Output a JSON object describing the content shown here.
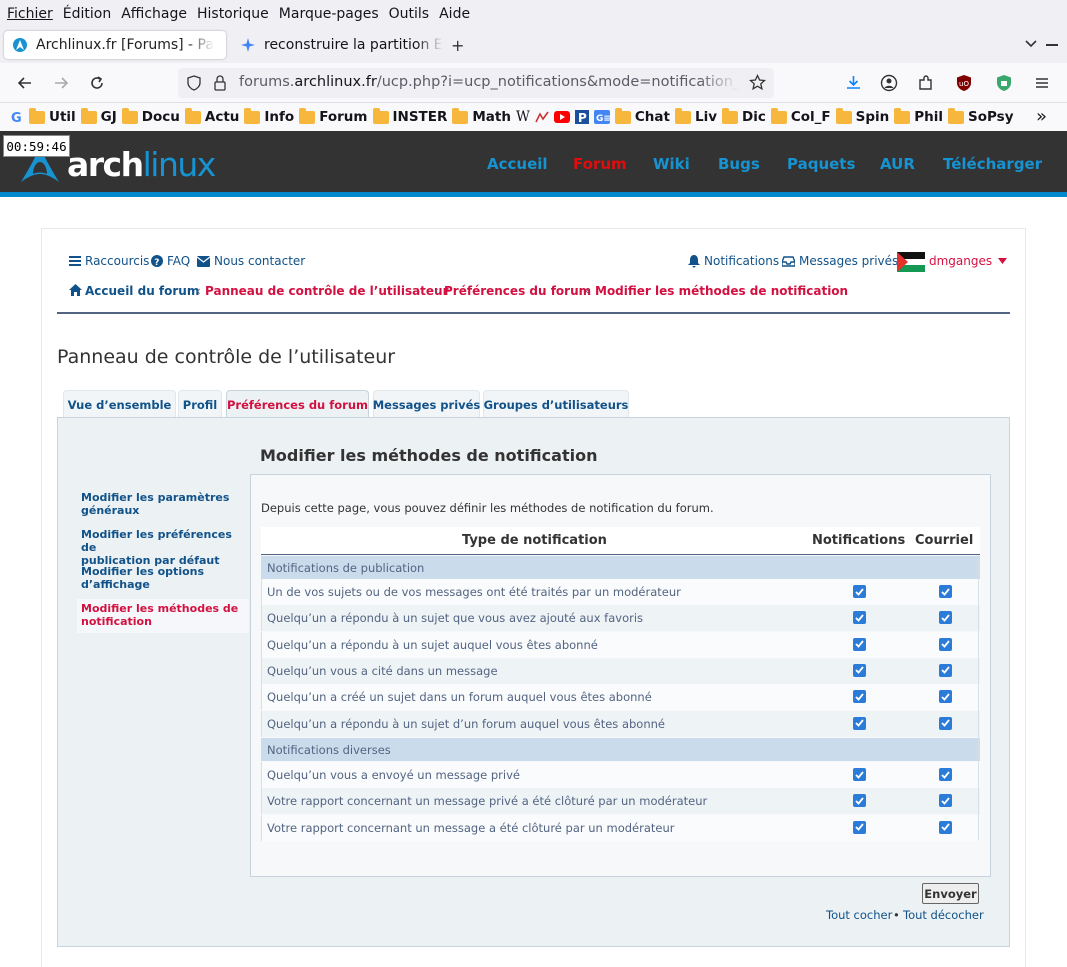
{
  "browser": {
    "menu": [
      "Fichier",
      "Édition",
      "Affichage",
      "Historique",
      "Marque-pages",
      "Outils",
      "Aide"
    ],
    "tabs": [
      {
        "title": "Archlinux.fr [Forums] - Pa"
      },
      {
        "title": "reconstruire la partition E"
      }
    ],
    "new_tab": "+",
    "url": {
      "prefix": "forums.",
      "domain": "archlinux.fr",
      "path": "/ucp.php?i=ucp_notifications&mode=notification_op"
    },
    "bookmarks": [
      "Util",
      "GJ",
      "Docu",
      "Actu",
      "Info",
      "Forum",
      "INSTER",
      "Math",
      "Chat",
      "Liv",
      "Dic",
      "Col_F",
      "Spin",
      "Phil",
      "SoPsy"
    ],
    "bookmark_overflow": "»"
  },
  "timer": "00:59:46",
  "arch": {
    "logo_part1": "arch",
    "logo_part2": "linux",
    "nav": [
      "Accueil",
      "Forum",
      "Wiki",
      "Bugs",
      "Paquets",
      "AUR",
      "Télécharger"
    ],
    "nav_active": "Forum"
  },
  "forum": {
    "top_links": {
      "shortcuts": "Raccourcis",
      "faq": "FAQ",
      "contact": "Nous contacter"
    },
    "user_links": {
      "notifications": "Notifications",
      "pm": "Messages privés",
      "username": "dmganges"
    },
    "breadcrumb": [
      "Accueil du forum",
      "Panneau de contrôle de l’utilisateur",
      "Préférences du forum",
      "Modifier les méthodes de notification"
    ],
    "panel_title": "Panneau de contrôle de l’utilisateur",
    "tabs": [
      "Vue d’ensemble",
      "Profil",
      "Préférences du forum",
      "Messages privés",
      "Groupes d’utilisateurs"
    ],
    "active_tab": "Préférences du forum",
    "sidebar": [
      {
        "line1": "Modifier les paramètres",
        "line2": "généraux"
      },
      {
        "line1": "Modifier les préférences de",
        "line2": "publication par défaut"
      },
      {
        "line1": "Modifier les options",
        "line2": "d’affichage"
      },
      {
        "line1": "Modifier les méthodes de",
        "line2": "notification"
      }
    ],
    "content_title": "Modifier les méthodes de notification",
    "description": "Depuis cette page, vous pouvez définir les méthodes de notification du forum.",
    "table": {
      "headers": {
        "type": "Type de notification",
        "notifications": "Notifications",
        "email": "Courriel"
      },
      "section1": "Notifications de publication",
      "rows1": [
        {
          "label": "Un de vos sujets ou de vos messages ont été traités par un modérateur",
          "notif": true,
          "email": true
        },
        {
          "label": "Quelqu’un a répondu à un sujet que vous avez ajouté aux favoris",
          "notif": true,
          "email": true
        },
        {
          "label": "Quelqu’un a répondu à un sujet auquel vous êtes abonné",
          "notif": true,
          "email": true
        },
        {
          "label": "Quelqu’un vous a cité dans un message",
          "notif": true,
          "email": true
        },
        {
          "label": "Quelqu’un a créé un sujet dans un forum auquel vous êtes abonné",
          "notif": true,
          "email": true
        },
        {
          "label": "Quelqu’un a répondu à un sujet d’un forum auquel vous êtes abonné",
          "notif": true,
          "email": true
        }
      ],
      "section2": "Notifications diverses",
      "rows2": [
        {
          "label": "Quelqu’un vous a envoyé un message privé",
          "notif": true,
          "email": true
        },
        {
          "label": "Votre rapport concernant un message privé a été clôturé par un modérateur",
          "notif": true,
          "email": true
        },
        {
          "label": "Votre rapport concernant un message a été clôturé par un modérateur",
          "notif": true,
          "email": true
        }
      ]
    },
    "submit": "Envoyer",
    "mark_all": "Tout cocher",
    "unmark_all": "Tout décocher",
    "mark_sep": "•"
  },
  "colors": {
    "arch_blue": "#1793d1",
    "forum_red": "#d31141",
    "link_blue": "#105289"
  }
}
